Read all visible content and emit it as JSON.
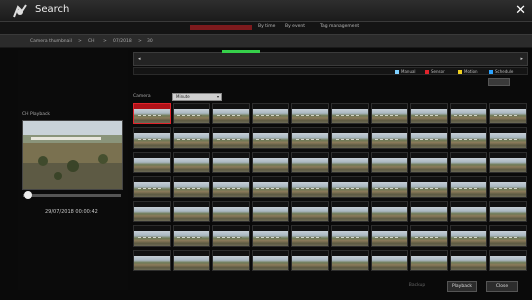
{
  "window": {
    "title": "Search",
    "close_icon": "close-icon",
    "title_icon": "search-gear-icon"
  },
  "tabs": [
    {
      "label": "",
      "active": true
    },
    {
      "label": "By time",
      "active": false
    },
    {
      "label": "By event",
      "active": false
    },
    {
      "label": "Tag management",
      "active": false
    }
  ],
  "breadcrumb": {
    "items": [
      "Camera thumbnail",
      "CH",
      "07/2018",
      "30"
    ]
  },
  "timeline": {
    "left_arrow": "◂",
    "right_arrow": "▸"
  },
  "legend": [
    {
      "label": "Manual",
      "color": "#7fd0ff"
    },
    {
      "label": "Sensor",
      "color": "#e0242c"
    },
    {
      "label": "Motion",
      "color": "#f0d020"
    },
    {
      "label": "Schedule",
      "color": "#2da4ff"
    }
  ],
  "colors": {
    "accent": "#e0242c",
    "timeline_marker": "#36d04a"
  },
  "left_panel": {
    "preview_label": "CH Playback",
    "current_time": "29/07/2018 00:00:42"
  },
  "playback_progress": 0.05,
  "camera_label": "Camera",
  "unit_select": {
    "value": "Minute"
  },
  "grid": {
    "rows": 7,
    "cols": 10
  },
  "footer": {
    "backup_label": "Backup",
    "playback_label": "Playback",
    "close_label": "Close"
  }
}
